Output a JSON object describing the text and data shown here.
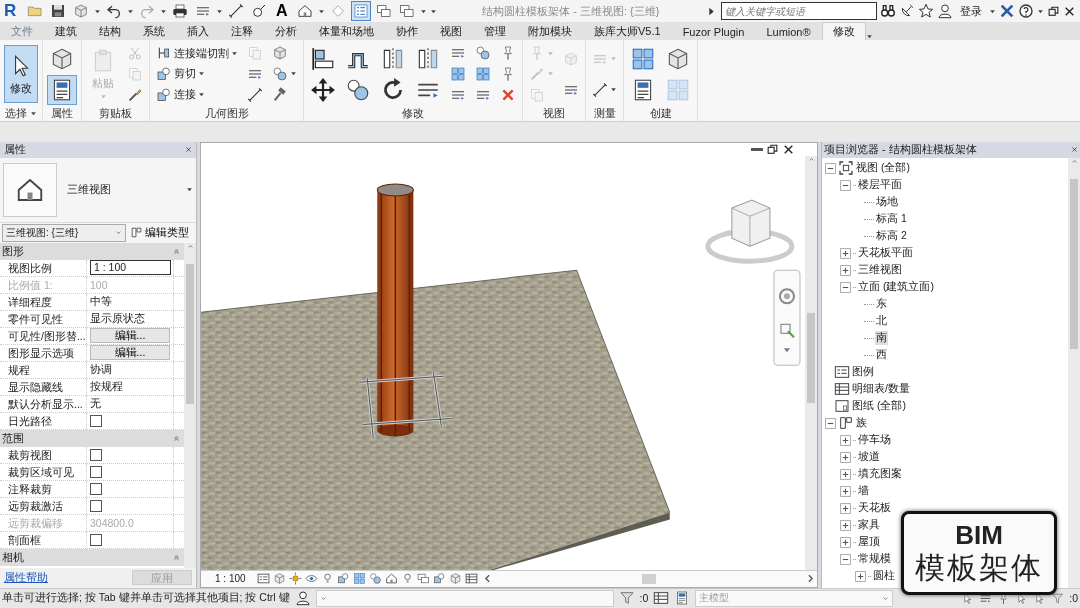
{
  "title_bar": {
    "logo": "R",
    "quick_access": [
      {
        "kind": "icon",
        "selected": false
      },
      {
        "kind": "icon",
        "selected": false
      },
      {
        "kind": "icon",
        "selected": false
      },
      {
        "kind": "icon",
        "selected": false
      },
      {
        "kind": "icon",
        "selected": false
      },
      {
        "kind": "icon",
        "selected": false
      },
      {
        "kind": "icon",
        "selected": false
      },
      {
        "kind": "icon",
        "selected": false
      },
      {
        "kind": "icon",
        "selected": false
      },
      {
        "kind": "text",
        "label": "A",
        "selected": false
      },
      {
        "kind": "icon",
        "selected": false
      },
      {
        "kind": "icon",
        "selected": false
      },
      {
        "kind": "icon",
        "selected": true
      },
      {
        "kind": "icon",
        "selected": false
      },
      {
        "kind": "icon",
        "selected": false
      }
    ],
    "title": "结构圆柱模板架体 - 三维视图: {三维}",
    "search": {
      "placeholder": "键入关键字或短语"
    },
    "sign_in": "登录"
  },
  "tabs": [
    {
      "label": "文件",
      "kind": "application",
      "selected": false
    },
    {
      "label": "建筑",
      "kind": "tab",
      "selected": false
    },
    {
      "label": "结构",
      "kind": "tab",
      "selected": false
    },
    {
      "label": "系统",
      "kind": "tab",
      "selected": false
    },
    {
      "label": "插入",
      "kind": "tab",
      "selected": false
    },
    {
      "label": "注释",
      "kind": "tab",
      "selected": false
    },
    {
      "label": "分析",
      "kind": "tab",
      "selected": false
    },
    {
      "label": "体量和场地",
      "kind": "tab",
      "selected": false
    },
    {
      "label": "协作",
      "kind": "tab",
      "selected": false
    },
    {
      "label": "视图",
      "kind": "tab",
      "selected": false
    },
    {
      "label": "管理",
      "kind": "tab",
      "selected": false
    },
    {
      "label": "附加模块",
      "kind": "tab",
      "selected": false
    },
    {
      "label": "族库大师V5.1",
      "kind": "tab",
      "selected": false
    },
    {
      "label": "Fuzor Plugin",
      "kind": "tab",
      "selected": false
    },
    {
      "label": "Lumion®",
      "kind": "tab",
      "selected": false
    },
    {
      "label": "修改",
      "kind": "tab",
      "selected": true
    }
  ],
  "ribbon": {
    "panels": [
      {
        "label": "选择",
        "menu": true,
        "columns": [
          [
            {
              "kind": "large",
              "label": "修改",
              "selected": true,
              "disabled": false,
              "dropdown": false
            }
          ]
        ]
      },
      {
        "label": "属性",
        "menu": false,
        "columns": [
          [
            {
              "kind": "bigicon",
              "selected": false,
              "disabled": false,
              "dropdown": false
            },
            {
              "kind": "bigicon",
              "selected": true,
              "disabled": false,
              "dropdown": false
            }
          ]
        ]
      },
      {
        "label": "剪贴板",
        "menu": false,
        "columns": [
          [
            {
              "kind": "large",
              "label": "粘贴",
              "selected": false,
              "disabled": true,
              "dropdown": true
            }
          ],
          [
            {
              "kind": "icon",
              "selected": false,
              "disabled": true,
              "dropdown": false
            },
            {
              "kind": "icon",
              "selected": false,
              "disabled": true,
              "dropdown": false
            },
            {
              "kind": "icon",
              "selected": false,
              "disabled": false,
              "dropdown": false
            }
          ]
        ]
      },
      {
        "label": "几何图形",
        "menu": false,
        "columns": [
          [
            {
              "kind": "row",
              "label": "连接端切割",
              "selected": false,
              "disabled": false,
              "dropdown": true
            },
            {
              "kind": "row",
              "label": "剪切",
              "selected": false,
              "disabled": false,
              "dropdown": true
            },
            {
              "kind": "row",
              "label": "连接",
              "selected": false,
              "disabled": false,
              "dropdown": true
            }
          ],
          [
            {
              "kind": "icon",
              "selected": false,
              "disabled": true,
              "dropdown": false
            },
            {
              "kind": "icon",
              "selected": false,
              "disabled": false,
              "dropdown": false
            },
            {
              "kind": "icon",
              "selected": false,
              "disabled": false,
              "dropdown": false
            }
          ],
          [
            {
              "kind": "icon",
              "selected": false,
              "disabled": false,
              "dropdown": false
            },
            {
              "kind": "icon",
              "selected": false,
              "disabled": false,
              "dropdown": true
            },
            {
              "kind": "icon",
              "selected": false,
              "disabled": false,
              "dropdown": false
            }
          ]
        ]
      },
      {
        "label": "修改",
        "menu": false,
        "columns": [
          [
            {
              "kind": "bigicon",
              "selected": false,
              "disabled": false,
              "dropdown": false
            },
            {
              "kind": "bigicon",
              "selected": false,
              "disabled": false,
              "dropdown": false
            }
          ],
          [
            {
              "kind": "bigicon",
              "selected": false,
              "disabled": false,
              "dropdown": false
            },
            {
              "kind": "bigicon",
              "selected": false,
              "disabled": false,
              "dropdown": false
            }
          ],
          [
            {
              "kind": "bigicon",
              "selected": false,
              "disabled": false,
              "dropdown": false
            },
            {
              "kind": "bigicon",
              "selected": false,
              "disabled": false,
              "dropdown": false
            }
          ],
          [
            {
              "kind": "bigicon",
              "selected": false,
              "disabled": false,
              "dropdown": false
            },
            {
              "kind": "bigicon",
              "selected": false,
              "disabled": false,
              "dropdown": false
            }
          ],
          [
            {
              "kind": "icon",
              "selected": false,
              "disabled": false,
              "dropdown": false
            },
            {
              "kind": "icon",
              "selected": false,
              "disabled": false,
              "dropdown": false
            },
            {
              "kind": "icon",
              "selected": false,
              "disabled": false,
              "dropdown": false
            }
          ],
          [
            {
              "kind": "icon",
              "selected": false,
              "disabled": false,
              "dropdown": false
            },
            {
              "kind": "icon",
              "selected": false,
              "disabled": false,
              "dropdown": false
            },
            {
              "kind": "icon",
              "selected": false,
              "disabled": false,
              "dropdown": false
            }
          ],
          [
            {
              "kind": "icon",
              "selected": false,
              "disabled": false,
              "dropdown": false
            },
            {
              "kind": "icon",
              "selected": false,
              "disabled": false,
              "dropdown": false
            },
            {
              "kind": "icon",
              "selected": false,
              "disabled": false,
              "dropdown": false
            }
          ]
        ]
      },
      {
        "label": "视图",
        "menu": false,
        "columns": [
          [
            {
              "kind": "icon",
              "selected": false,
              "disabled": true,
              "dropdown": true
            },
            {
              "kind": "icon",
              "selected": false,
              "disabled": true,
              "dropdown": true
            },
            {
              "kind": "icon",
              "selected": false,
              "disabled": true,
              "dropdown": false
            }
          ],
          [
            {
              "kind": "icon",
              "selected": false,
              "disabled": true,
              "dropdown": false
            },
            {
              "kind": "icon",
              "selected": false,
              "disabled": false,
              "dropdown": false
            }
          ]
        ]
      },
      {
        "label": "测量",
        "menu": false,
        "columns": [
          [
            {
              "kind": "icon",
              "selected": false,
              "disabled": true,
              "dropdown": true
            },
            {
              "kind": "icon",
              "selected": false,
              "disabled": false,
              "dropdown": true
            }
          ]
        ]
      },
      {
        "label": "创建",
        "menu": false,
        "columns": [
          [
            {
              "kind": "bigicon",
              "selected": false,
              "disabled": false,
              "dropdown": false
            },
            {
              "kind": "bigicon",
              "selected": false,
              "disabled": false,
              "dropdown": false
            }
          ],
          [
            {
              "kind": "bigicon",
              "selected": false,
              "disabled": false,
              "dropdown": false
            },
            {
              "kind": "bigicon",
              "selected": false,
              "disabled": true,
              "dropdown": false
            }
          ]
        ]
      }
    ]
  },
  "properties": {
    "title": "属性",
    "type_name": "三维视图",
    "selector": "三维视图: {三维}",
    "edit_type": "编辑类型",
    "sections": [
      {
        "title": "图形",
        "expanded": true,
        "rows": [
          {
            "label": "视图比例",
            "kind": "input",
            "value": "1 : 100",
            "disabled": false
          },
          {
            "label": "比例值 1:",
            "kind": "text",
            "value": "100",
            "disabled": true
          },
          {
            "label": "详细程度",
            "kind": "text",
            "value": "中等",
            "disabled": false
          },
          {
            "label": "零件可见性",
            "kind": "text",
            "value": "显示原状态",
            "disabled": false
          },
          {
            "label": "可见性/图形替...",
            "kind": "button",
            "value": "编辑...",
            "disabled": false
          },
          {
            "label": "图形显示选项",
            "kind": "button",
            "value": "编辑...",
            "disabled": false
          },
          {
            "label": "规程",
            "kind": "text",
            "value": "协调",
            "disabled": false
          },
          {
            "label": "显示隐藏线",
            "kind": "text",
            "value": "按规程",
            "disabled": false
          },
          {
            "label": "默认分析显示...",
            "kind": "text",
            "value": "无",
            "disabled": false
          },
          {
            "label": "日光路径",
            "kind": "checkbox",
            "checked": false,
            "disabled": false
          }
        ]
      },
      {
        "title": "范围",
        "expanded": true,
        "rows": [
          {
            "label": "裁剪视图",
            "kind": "checkbox",
            "checked": false,
            "disabled": false
          },
          {
            "label": "裁剪区域可见",
            "kind": "checkbox",
            "checked": false,
            "disabled": false
          },
          {
            "label": "注释裁剪",
            "kind": "checkbox",
            "checked": false,
            "disabled": false
          },
          {
            "label": "远剪裁激活",
            "kind": "checkbox",
            "checked": false,
            "disabled": false
          },
          {
            "label": "远剪裁偏移",
            "kind": "text",
            "value": "304800.0",
            "disabled": true
          },
          {
            "label": "剖面框",
            "kind": "checkbox",
            "checked": false,
            "disabled": false
          }
        ]
      },
      {
        "title": "相机",
        "expanded": true
      }
    ],
    "help_link": "属性帮助",
    "apply": {
      "label": "应用",
      "disabled": true
    }
  },
  "view": {
    "scale": "1 : 100"
  },
  "project_browser": {
    "title": "项目浏览器 - 结构圆柱模板架体",
    "tree": [
      {
        "label": "视图 (全部)",
        "kind": "views",
        "expanded": true,
        "selected": false,
        "children": [
          {
            "label": "楼层平面",
            "kind": "node",
            "expanded": true,
            "selected": false,
            "children": [
              {
                "label": "场地",
                "kind": "leaf",
                "selected": false
              },
              {
                "label": "标高 1",
                "kind": "leaf",
                "selected": false
              },
              {
                "label": "标高 2",
                "kind": "leaf",
                "selected": false
              }
            ]
          },
          {
            "label": "天花板平面",
            "kind": "node",
            "expanded": false,
            "selected": false
          },
          {
            "label": "三维视图",
            "kind": "node",
            "expanded": false,
            "selected": false
          },
          {
            "label": "立面 (建筑立面)",
            "kind": "node",
            "expanded": true,
            "selected": false,
            "children": [
              {
                "label": "东",
                "kind": "leaf",
                "selected": false
              },
              {
                "label": "北",
                "kind": "leaf",
                "selected": false
              },
              {
                "label": "南",
                "kind": "leaf",
                "selected": true
              },
              {
                "label": "西",
                "kind": "leaf",
                "selected": false
              }
            ]
          }
        ]
      },
      {
        "label": "图例",
        "kind": "legend",
        "selected": false
      },
      {
        "label": "明细表/数量",
        "kind": "schedule",
        "selected": false
      },
      {
        "label": "图纸 (全部)",
        "kind": "sheets",
        "selected": false
      },
      {
        "label": "族",
        "kind": "families",
        "expanded": true,
        "selected": false,
        "children": [
          {
            "label": "停车场",
            "kind": "node",
            "expanded": false,
            "selected": false
          },
          {
            "label": "坡道",
            "kind": "node",
            "expanded": false,
            "selected": false
          },
          {
            "label": "填充图案",
            "kind": "node",
            "expanded": false,
            "selected": false
          },
          {
            "label": "墙",
            "kind": "node",
            "expanded": false,
            "selected": false
          },
          {
            "label": "天花板",
            "kind": "node",
            "expanded": false,
            "selected": false
          },
          {
            "label": "家具",
            "kind": "node",
            "expanded": false,
            "selected": false
          },
          {
            "label": "屋顶",
            "kind": "node",
            "expanded": false,
            "selected": false
          },
          {
            "label": "常规模",
            "kind": "node",
            "expanded": true,
            "selected": false,
            "children": [
              {
                "label": "圆柱",
                "kind": "node",
                "expanded": false,
                "selected": false
              }
            ]
          }
        ]
      }
    ]
  },
  "status_bar": {
    "message": "单击可进行选择; 按 Tab 键并单击可选择其他项目; 按 Ctrl 键",
    "filter_count": ":0",
    "workset": "主模型",
    "selection_count": ":0"
  },
  "caption": {
    "line_1": "BIM",
    "line_2": "模板架体"
  }
}
